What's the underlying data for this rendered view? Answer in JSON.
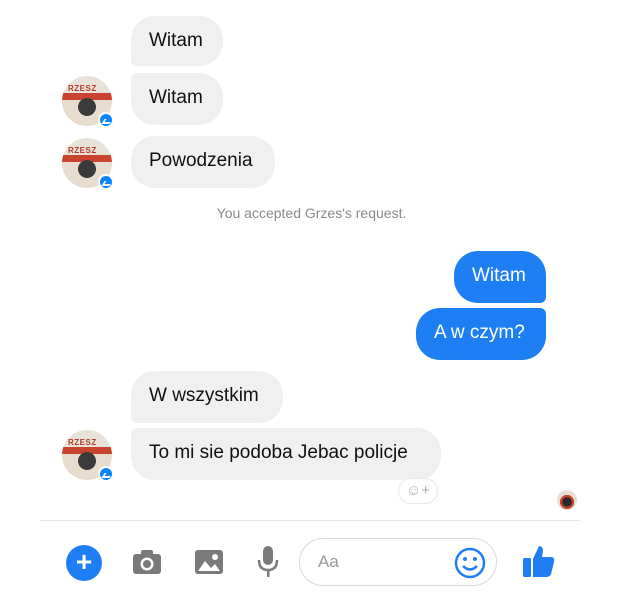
{
  "messages": [
    {
      "id": "m1",
      "text": "Witam",
      "direction": "incoming"
    },
    {
      "id": "m2",
      "text": "Witam",
      "direction": "incoming"
    },
    {
      "id": "m3",
      "text": "Powodzenia",
      "direction": "incoming"
    },
    {
      "id": "m4",
      "text": "Witam",
      "direction": "outgoing"
    },
    {
      "id": "m5",
      "text": "A w czym?",
      "direction": "outgoing"
    },
    {
      "id": "m6",
      "text": "W wszystkim",
      "direction": "incoming"
    },
    {
      "id": "m7",
      "text": "To mi sie podoba Jebac policje",
      "direction": "incoming"
    }
  ],
  "system_message": "You accepted Grzes's request.",
  "avatar_sign": "RZESZ",
  "composer": {
    "placeholder": "Aa",
    "icons": [
      "plus-icon",
      "camera-icon",
      "image-icon",
      "mic-icon",
      "emoji-icon",
      "like-icon"
    ]
  },
  "colors": {
    "accent": "#1e7ff5",
    "incoming_bubble": "#f0f0f0",
    "system_text": "#8a8a8a"
  }
}
